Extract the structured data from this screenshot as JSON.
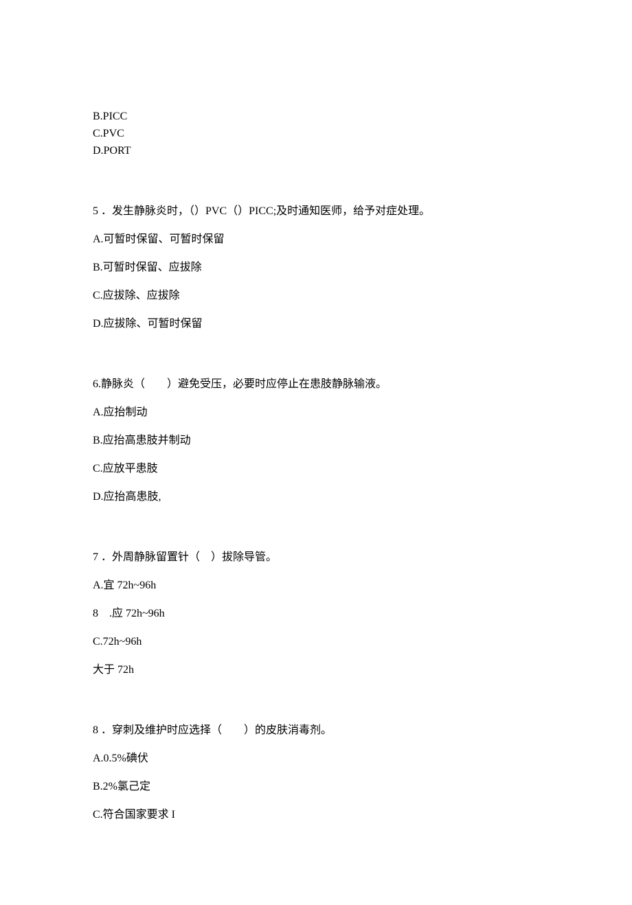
{
  "q4_tail": {
    "b": "B.PICC",
    "c": "C.PVC",
    "d": "D.PORT"
  },
  "q5": {
    "stem": "5 ．发生静脉炎时，（）PVC（）PICC;及时通知医师，给予对症处理。",
    "a": "A.可暂时保留、可暂时保留",
    "b": "B.可暂时保留、应拔除",
    "c": "C.应拔除、应拔除",
    "d": "D.应拔除、可暂时保留"
  },
  "q6": {
    "stem": "6.静脉炎（　　）避免受压，必要时应停止在患肢静脉输液。",
    "a": "A.应抬制动",
    "b": "B.应抬高患肢并制动",
    "c": "C.应放平患肢",
    "d": "D.应抬高患肢,"
  },
  "q7": {
    "stem": "7 ．外周静脉留置针（　）拔除导管。",
    "a": "A.宜 72h~96h",
    "b": "8　.应 72h~96h",
    "c": "C.72h~96h",
    "d": "大于 72h"
  },
  "q8": {
    "stem": "8 ．穿刺及维护时应选择（　　）的皮肤消毒剂。",
    "a": "A.0.5%碘伏",
    "b": "B.2%氯己定",
    "c": "C.符合国家要求 I"
  }
}
